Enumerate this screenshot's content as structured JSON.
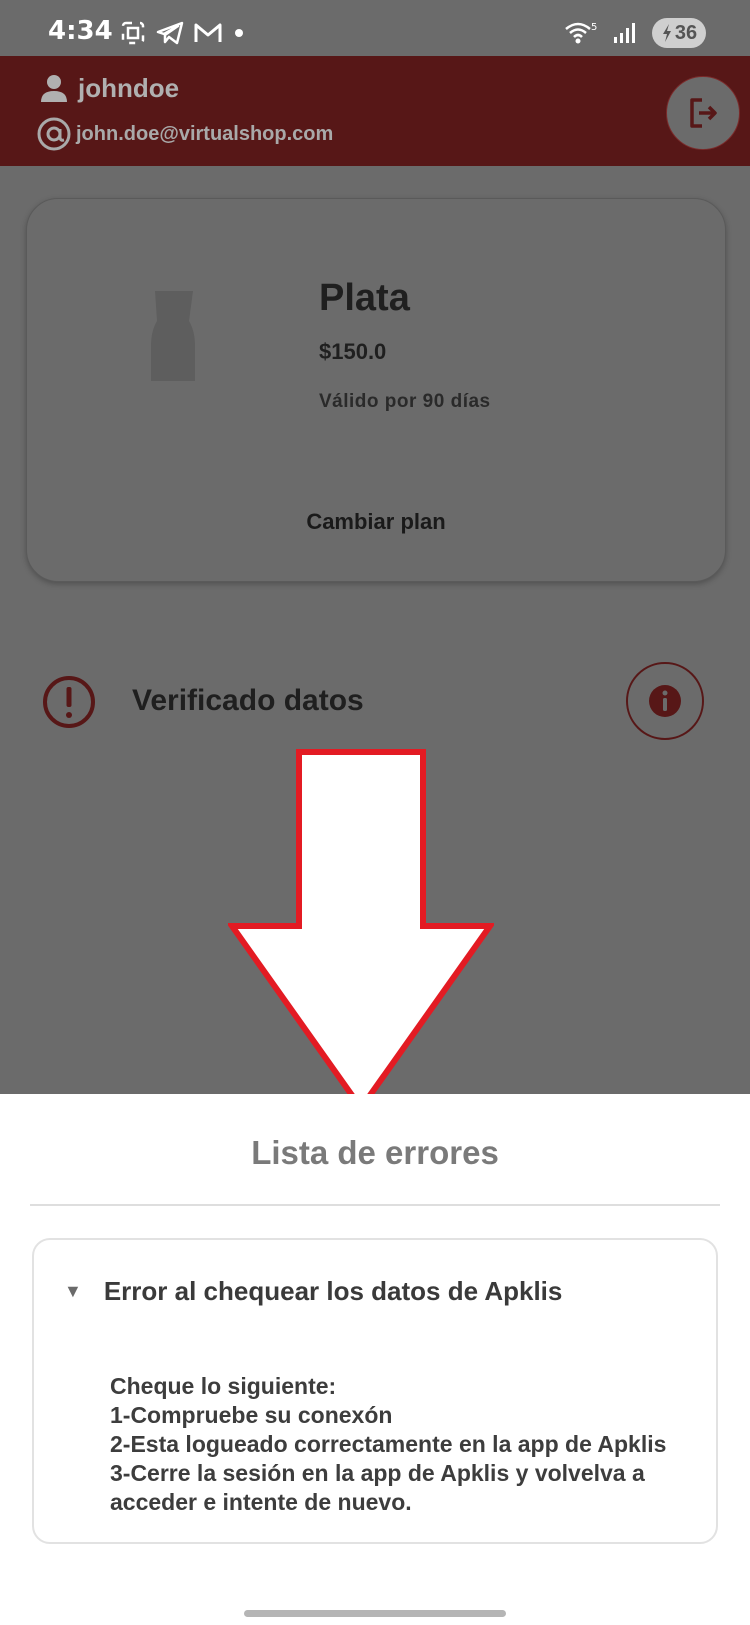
{
  "status_bar": {
    "time": "4:34",
    "battery_level": "36",
    "wifi_label": "5",
    "icons": [
      "screenshot-icon",
      "telegram-icon",
      "gmail-icon",
      "dot-icon",
      "wifi-icon",
      "signal-icon",
      "battery-charging-icon"
    ]
  },
  "header": {
    "username": "johndoe",
    "email": "john.doe@virtualshop.com",
    "background_color": "#571717"
  },
  "plan": {
    "name": "Plata",
    "price": "$150.0",
    "validity": "Válido por 90 días",
    "change_plan_label": "Cambiar plan"
  },
  "verification": {
    "status_text": "Verificado datos",
    "status_icon": "exclamation-circle-icon",
    "info_icon": "info-icon"
  },
  "error_sheet": {
    "title": "Lista de errores",
    "errors": [
      {
        "title": "Error al chequear los datos de Apklis",
        "expanded": true,
        "lines": [
          "Cheque lo siguiente:",
          "1-Compruebe su conexón",
          "2-Esta logueado correctamente en la app de Apklis",
          "3-Cerre la sesión en la app de Apklis y volvelva a",
          "acceder e intente de nuevo."
        ]
      }
    ]
  },
  "colors": {
    "accent": "#571717",
    "overlay_gray": "#6b6b6b",
    "arrow_outline": "#e31b23"
  }
}
